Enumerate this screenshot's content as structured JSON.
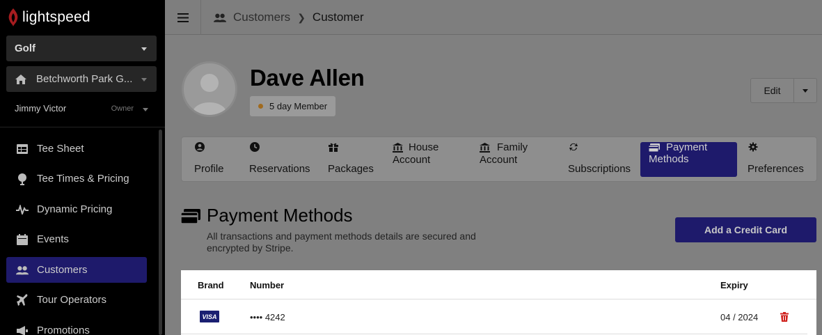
{
  "sidebar": {
    "logo_text": "lightspeed",
    "organization_select": "Golf",
    "course_select": "Betchworth Park G...",
    "user": {
      "name": "Jimmy Victor",
      "role": "Owner"
    },
    "nav": [
      {
        "label": "Tee Sheet",
        "icon": "table-icon"
      },
      {
        "label": "Tee Times & Pricing",
        "icon": "golf-ball-icon"
      },
      {
        "label": "Dynamic Pricing",
        "icon": "pulse-icon"
      },
      {
        "label": "Events",
        "icon": "calendar-icon"
      },
      {
        "label": "Customers",
        "icon": "users-icon"
      },
      {
        "label": "Tour Operators",
        "icon": "plane-icon"
      },
      {
        "label": "Promotions",
        "icon": "megaphone-icon"
      }
    ],
    "active_item": "Customers"
  },
  "header": {
    "breadcrumb_parent": "Customers",
    "breadcrumb_current": "Customer"
  },
  "customer": {
    "name": "Dave Allen",
    "membership_badge": "5 day Member",
    "edit_label": "Edit"
  },
  "tabs": [
    {
      "line1": "",
      "line2": "Profile",
      "icon": "user-circle-icon"
    },
    {
      "line1": "",
      "line2": "Reservations",
      "icon": "clock-icon"
    },
    {
      "line1": "",
      "line2": "Packages",
      "icon": "gift-icon"
    },
    {
      "line1": "House",
      "line2": "Account",
      "icon": "bank-icon"
    },
    {
      "line1": "Family",
      "line2": "Account",
      "icon": "bank-icon"
    },
    {
      "line1": "",
      "line2": "Subscriptions",
      "icon": "sync-icon"
    },
    {
      "line1": "Payment",
      "line2": "Methods",
      "icon": "credit-card-icon"
    },
    {
      "line1": "",
      "line2": "Preferences",
      "icon": "gear-icon"
    }
  ],
  "active_tab": "Payment Methods",
  "payment_methods": {
    "title": "Payment Methods",
    "description": "All transactions and payment methods details are secured and encrypted by Stripe.",
    "add_button": "Add a Credit Card",
    "columns": {
      "brand": "Brand",
      "number": "Number",
      "expiry": "Expiry"
    },
    "cards": [
      {
        "brand": "VISA",
        "number": "•••• 4242",
        "expiry": "04 / 2024"
      }
    ]
  },
  "colors": {
    "accent": "#2c26c0",
    "logo_red": "#e0262d",
    "delete_red": "#d0231f"
  }
}
